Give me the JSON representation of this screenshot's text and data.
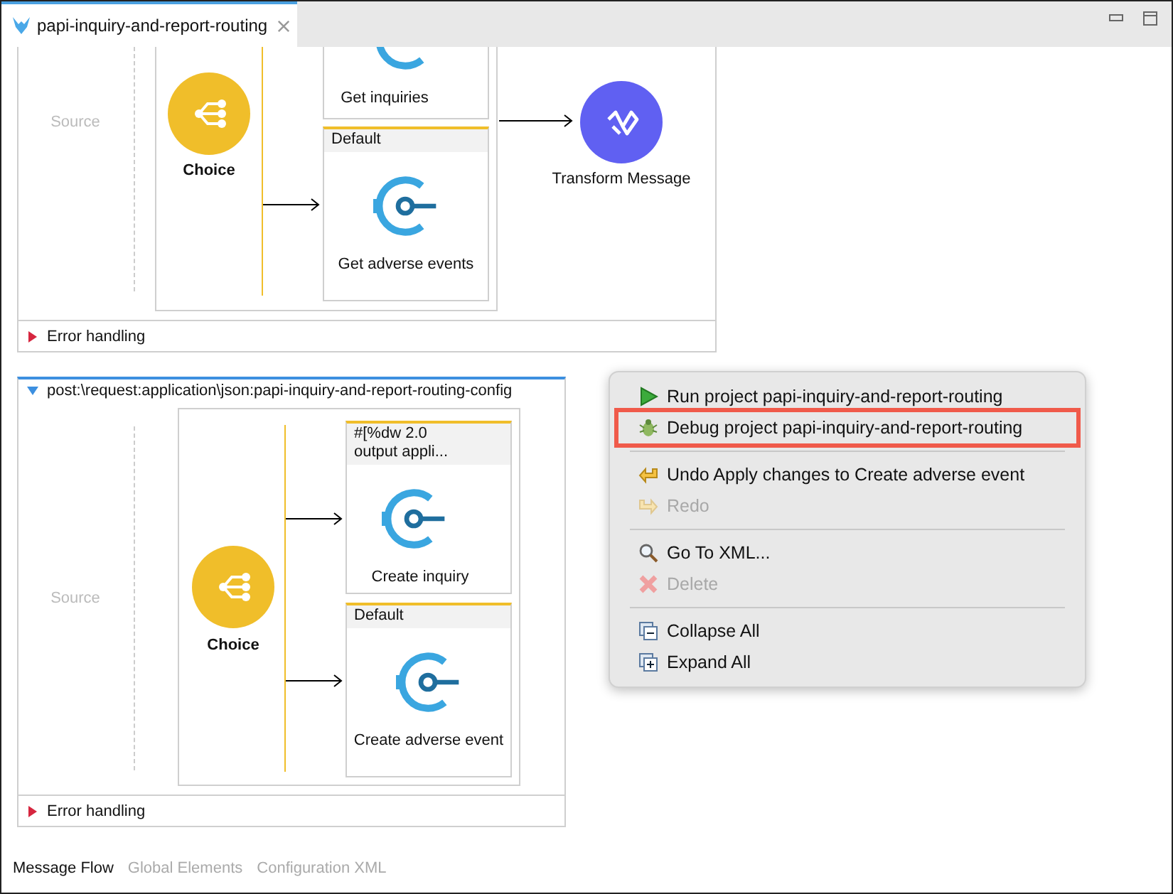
{
  "editor_tab": {
    "title": "papi-inquiry-and-report-routing"
  },
  "flows": [
    {
      "source": "Source",
      "choice": "Choice",
      "routes": [
        {
          "label": "Get inquiries"
        },
        {
          "header": "Default",
          "label": "Get adverse events"
        }
      ],
      "next": {
        "label": "Transform Message"
      },
      "error_handling": {
        "label": "Error handling",
        "expanded": false
      }
    },
    {
      "title": "post:\\request:application\\json:papi-inquiry-and-report-routing-config",
      "expanded": true,
      "source": "Source",
      "choice": "Choice",
      "routes": [
        {
          "header": "#[%dw 2.0\noutput appli...",
          "label": "Create inquiry"
        },
        {
          "header": "Default",
          "label": "Create adverse event"
        }
      ],
      "error_handling": {
        "label": "Error handling",
        "expanded": false
      }
    }
  ],
  "context_menu": {
    "groups": [
      [
        {
          "label": "Run project papi-inquiry-and-report-routing",
          "disabled": false,
          "highlighted": false
        },
        {
          "label": "Debug project papi-inquiry-and-report-routing",
          "disabled": false,
          "highlighted": true
        }
      ],
      [
        {
          "label": "Undo Apply changes to Create adverse event",
          "disabled": false,
          "highlighted": false
        },
        {
          "label": "Redo",
          "disabled": true,
          "highlighted": false
        }
      ],
      [
        {
          "label": "Go To XML...",
          "disabled": false,
          "highlighted": false
        },
        {
          "label": "Delete",
          "disabled": true,
          "highlighted": false
        }
      ],
      [
        {
          "label": "Collapse All",
          "disabled": false,
          "highlighted": false
        },
        {
          "label": "Expand All",
          "disabled": false,
          "highlighted": false
        }
      ]
    ]
  },
  "bottom_tabs": [
    {
      "label": "Message Flow",
      "selected": true
    },
    {
      "label": "Global Elements",
      "selected": false
    },
    {
      "label": "Configuration XML",
      "selected": false
    }
  ]
}
